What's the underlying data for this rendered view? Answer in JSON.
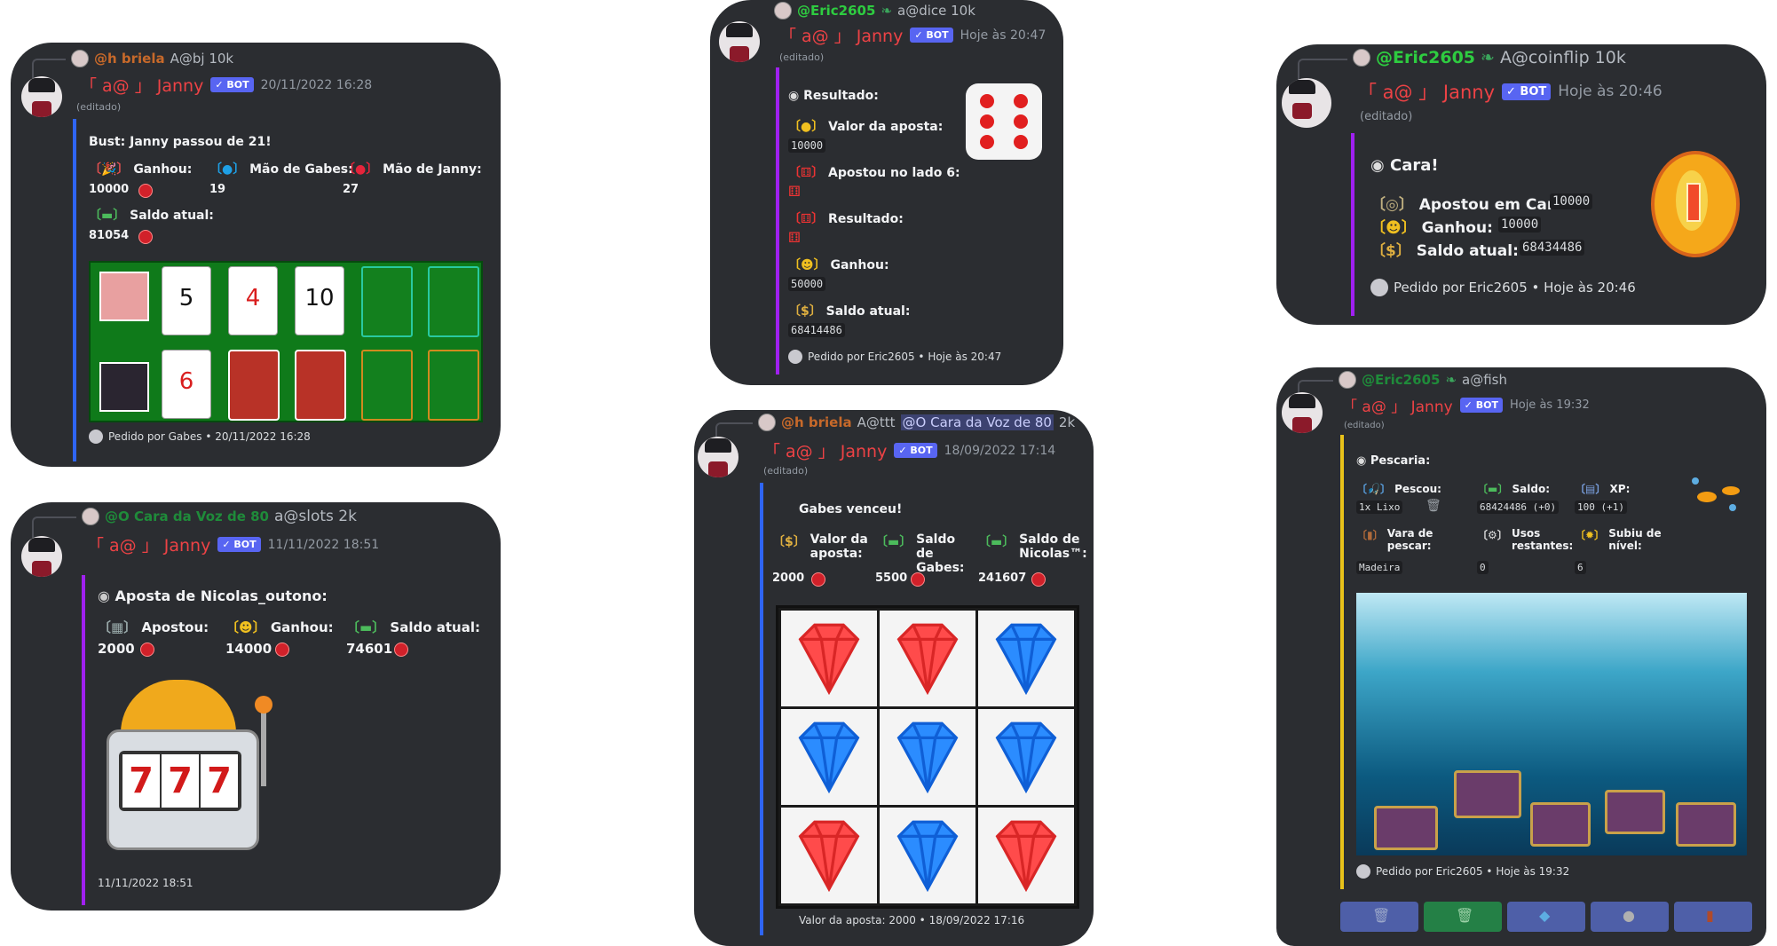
{
  "colors": {
    "background": "#ffffff",
    "card": "#2b2d31",
    "bot_name": "#ed4245",
    "badge": "#5865f2",
    "blue_bar": "#2f65f5",
    "purple_bar": "#a020f0",
    "yellow_bar": "#e8c21a",
    "green_user": "#2ecc40"
  },
  "bot": {
    "name": "「 a@ 」 Janny",
    "badge": "✓ BOT",
    "edited": "(editado)"
  },
  "blackjack": {
    "reply_user": "@h briela",
    "reply_cmd": "A@bj 10k",
    "timestamp": "20/11/2022 16:28",
    "bust": "Bust: Janny passou de 21!",
    "won_label": "Ganhou:",
    "won_value": "10000",
    "hand_gabes_label": "Mão de Gabes:",
    "hand_gabes_value": "19",
    "hand_janny_label": "Mão de Janny:",
    "hand_janny_value": "27",
    "balance_label": "Saldo atual:",
    "balance_value": "81054",
    "top_cards": [
      "5",
      "4",
      "10"
    ],
    "bottom_cards": [
      "6"
    ],
    "footer": "Pedido por Gabes • 20/11/2022 16:28"
  },
  "slots": {
    "reply_user": "@O Cara da Voz de 80",
    "reply_cmd": "a@slots 2k",
    "timestamp": "11/11/2022 18:51",
    "title": "Aposta de Nicolas_outono:",
    "bet_label": "Apostou:",
    "bet_value": "2000",
    "won_label": "Ganhou:",
    "won_value": "14000",
    "balance_label": "Saldo atual:",
    "balance_value": "74601",
    "reels": [
      "7",
      "7",
      "7"
    ],
    "footer": "11/11/2022 18:51"
  },
  "dice": {
    "reply_user": "@Eric2605",
    "reply_cmd": "a@dice 10k",
    "timestamp": "Hoje às 20:47",
    "result_title": "Resultado:",
    "bet_label": "Valor da aposta:",
    "bet_value": "10000",
    "side_label": "Apostou no lado 6:",
    "result_label": "Resultado:",
    "won_label": "Ganhou:",
    "won_value": "50000",
    "balance_label": "Saldo atual:",
    "balance_value": "68414486",
    "footer": "Pedido por Eric2605 • Hoje às 20:47"
  },
  "ttt": {
    "reply_user": "@h briela",
    "reply_cmd": "A@ttt",
    "mention": "@O Cara da Voz de 80",
    "reply_extra": "2k",
    "timestamp": "18/09/2022 17:14",
    "winner": "Gabes venceu!",
    "bet_label": "Valor da aposta:",
    "bet_value": "2000",
    "gabes_label": "Saldo de Gabes:",
    "gabes_value": "5500",
    "nicolas_label": "Saldo de Nicolas™:",
    "nicolas_value": "241607",
    "grid": [
      [
        "red",
        "red",
        "blue"
      ],
      [
        "blue",
        "blue",
        "blue"
      ],
      [
        "red",
        "blue",
        "red"
      ]
    ],
    "footer": "Valor da aposta: 2000 • 18/09/2022 17:16"
  },
  "coinflip": {
    "reply_user": "@Eric2605",
    "reply_cmd": "A@coinflip 10k",
    "timestamp": "Hoje às 20:46",
    "title": "Cara!",
    "bet_label": "Apostou em Cara:",
    "bet_value": "10000",
    "won_label": "Ganhou:",
    "won_value": "10000",
    "balance_label": "Saldo atual:",
    "balance_value": "68434486",
    "footer": "Pedido por Eric2605 • Hoje às 20:46"
  },
  "fish": {
    "reply_user": "@Eric2605",
    "reply_cmd": "a@fish",
    "timestamp": "Hoje às 19:32",
    "title": "Pescaria:",
    "caught_label": "Pescou:",
    "caught_value": "1x Lixo",
    "balance_label": "Saldo:",
    "balance_value": "68424486 (+0)",
    "xp_label": "XP:",
    "xp_value": "100 (+1)",
    "rod_label": "Vara de pescar:",
    "rod_value": "Madeira",
    "uses_label": "Usos restantes:",
    "uses_value": "0",
    "level_label": "Subiu de nível:",
    "level_value": "6",
    "footer": "Pedido por Eric2605 • Hoje às 19:32"
  }
}
